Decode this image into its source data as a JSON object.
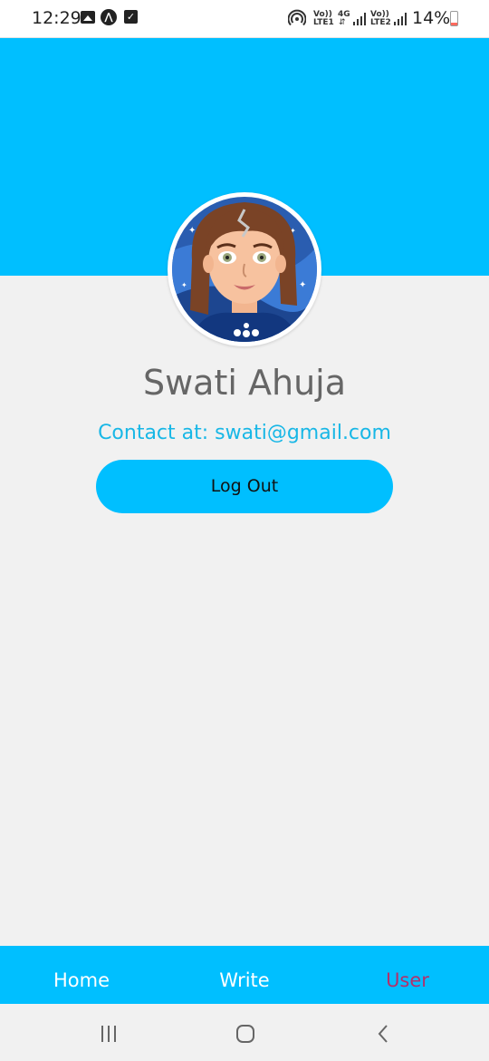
{
  "status_bar": {
    "time": "12:29",
    "volte1": "Vo))",
    "lte1": "LTE1",
    "net4g": "4G",
    "volte2": "Vo))",
    "lte2": "LTE2",
    "battery": "14%",
    "icons": [
      "gallery-icon",
      "a-icon",
      "check-icon",
      "hotspot-icon",
      "signal-icon",
      "battery-icon"
    ]
  },
  "profile": {
    "name": "Swati Ahuja",
    "contact": "Contact at: swati@gmail.com",
    "logout_label": "Log Out"
  },
  "tabs": [
    {
      "label": "Home",
      "active": false
    },
    {
      "label": "Write",
      "active": false
    },
    {
      "label": "User",
      "active": true
    }
  ],
  "colors": {
    "accent": "#00bfff",
    "background": "#f1f1f1",
    "name_text": "#666666",
    "contact_text": "#18b7e6",
    "active_tab": "#b3306b"
  },
  "nav": {
    "icons": [
      "recent-apps-icon",
      "home-icon",
      "back-icon"
    ]
  }
}
